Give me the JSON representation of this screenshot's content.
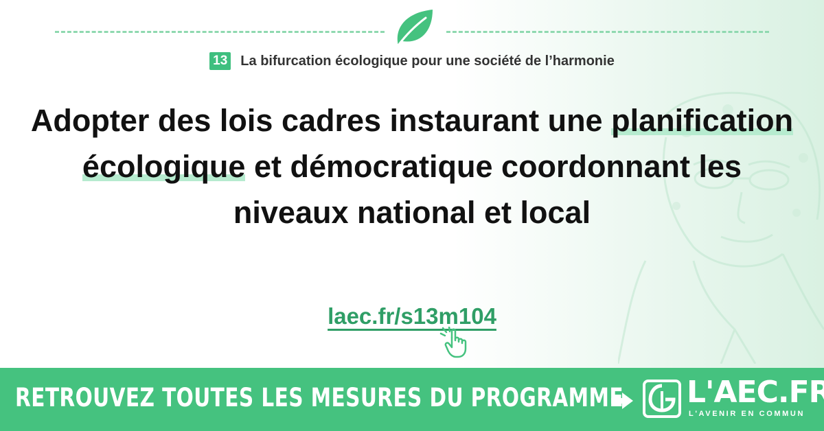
{
  "category": {
    "number": "13",
    "title": "La bifurcation écologique pour une société de l’harmonie"
  },
  "headline": {
    "part1": "Adopter des lois cadres instaurant une ",
    "highlight": "planification écologique",
    "part2": " et démocratique coordonnant les niveaux national et local"
  },
  "link": {
    "text": "laec.fr/s13m104"
  },
  "footer": {
    "cta": "RETROUVEZ TOUTES LES MESURES DU PROGRAMME",
    "logo_text": "L'AEC.FR",
    "logo_sub": "L'AVENIR EN COMMUN"
  },
  "colors": {
    "accent": "#45c27f",
    "link": "#2f9e66",
    "highlight": "#b6ebcf"
  },
  "icons": {
    "leaf": "leaf-icon",
    "cursor": "pointer-hand-icon",
    "arrow": "arrow-right-icon",
    "logo": "laec-logo-icon"
  }
}
